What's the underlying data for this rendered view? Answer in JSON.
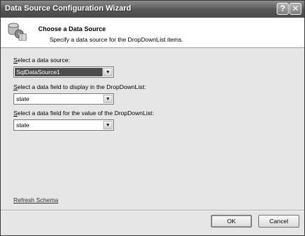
{
  "window": {
    "title": "Data Source Configuration Wizard",
    "help_label": "?",
    "close_label": "✕"
  },
  "header": {
    "title": "Choose a Data Source",
    "subtitle": "Specify a data source for the DropDownList items."
  },
  "fields": [
    {
      "label_access": "S",
      "label_rest": "elect a data source:",
      "value": "SqlDataSource1",
      "icon": "chevron-down-icon"
    },
    {
      "label_access": "S",
      "label_rest": "elect a data field to display in the DropDownList:",
      "value": "state",
      "icon": "chevron-down-icon"
    },
    {
      "label_access": "S",
      "label_rest": "elect a data field for the value of the DropDownList:",
      "value": "state",
      "icon": "chevron-down-icon"
    }
  ],
  "refresh_link": "Refresh Schema",
  "buttons": {
    "ok": "OK",
    "cancel": "Cancel"
  },
  "arrow_glyph": "▼"
}
